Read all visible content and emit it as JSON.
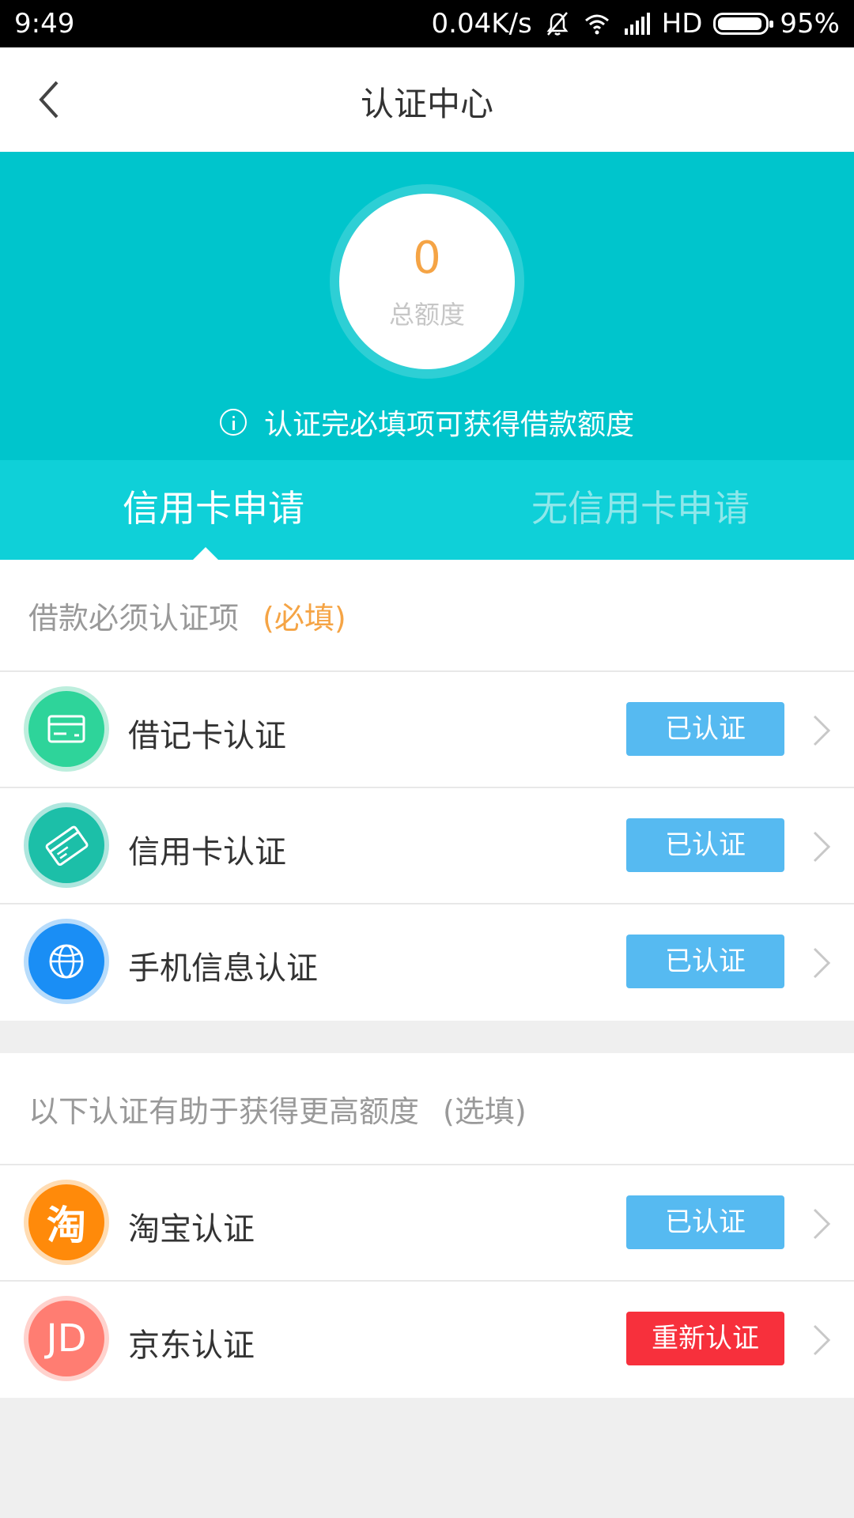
{
  "status_bar": {
    "time": "9:49",
    "net_speed": "0.04K/s",
    "hd": "HD",
    "battery": "95%"
  },
  "nav": {
    "title": "认证中心"
  },
  "hero": {
    "quota_value": "0",
    "quota_label": "总额度",
    "tip": "认证完必填项可获得借款额度"
  },
  "tabs": [
    {
      "label": "信用卡申请",
      "active": true
    },
    {
      "label": "无信用卡申请",
      "active": false
    }
  ],
  "required_section": {
    "title": "借款必须认证项",
    "tag": "(必填)",
    "items": [
      {
        "label": "借记卡认证",
        "status": "已认证",
        "icon": "debit-card-icon"
      },
      {
        "label": "信用卡认证",
        "status": "已认证",
        "icon": "credit-card-icon"
      },
      {
        "label": "手机信息认证",
        "status": "已认证",
        "icon": "globe-phone-icon"
      }
    ]
  },
  "optional_section": {
    "title": "以下认证有助于获得更高额度",
    "tag": "(选填)",
    "items": [
      {
        "label": "淘宝认证",
        "status": "已认证",
        "icon": "taobao-icon",
        "glyph": "淘"
      },
      {
        "label": "京东认证",
        "status": "重新认证",
        "icon": "jd-icon",
        "glyph": "JD"
      }
    ]
  },
  "colors": {
    "accent": "#00c5cc",
    "tab_bar": "#0fd0d8",
    "verified": "#56baf1",
    "reverify": "#f7303c",
    "required_tag": "#f5a445"
  }
}
